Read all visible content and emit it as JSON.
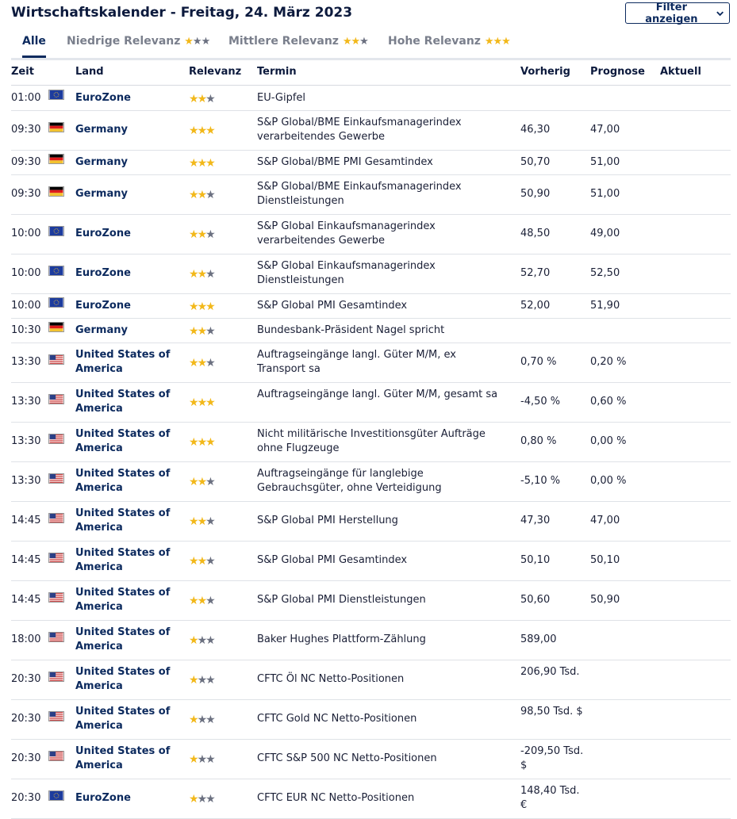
{
  "header": {
    "title": "Wirtschaftskalender - Freitag, 24. März 2023",
    "filter_label": "Filter anzeigen"
  },
  "tabs": [
    {
      "label": "Alle",
      "stars": 0,
      "active": true
    },
    {
      "label": "Niedrige Relevanz",
      "stars": 1,
      "active": false
    },
    {
      "label": "Mittlere Relevanz",
      "stars": 2,
      "active": false
    },
    {
      "label": "Hohe Relevanz",
      "stars": 3,
      "active": false
    }
  ],
  "columns": {
    "zeit": "Zeit",
    "land": "Land",
    "relevanz": "Relevanz",
    "termin": "Termin",
    "vorherig": "Vorherig",
    "prognose": "Prognose",
    "aktuell": "Aktuell"
  },
  "colors": {
    "brand": "#0c2a5e",
    "star_on": "#f2b81a",
    "star_off": "#6b7080"
  },
  "rows": [
    {
      "zeit": "01:00",
      "flag": "eu-flag-icon",
      "land": "EuroZone",
      "stars": 2,
      "termin": "EU-Gipfel",
      "vorherig": "",
      "prognose": "",
      "aktuell": ""
    },
    {
      "zeit": "09:30",
      "flag": "de-flag-icon",
      "land": "Germany",
      "stars": 3,
      "termin": "S&P Global/BME Einkaufsmanagerindex verarbeitendes Gewerbe",
      "vorherig": "46,30",
      "prognose": "47,00",
      "aktuell": ""
    },
    {
      "zeit": "09:30",
      "flag": "de-flag-icon",
      "land": "Germany",
      "stars": 3,
      "termin": "S&P Global/BME PMI Gesamtindex",
      "vorherig": "50,70",
      "prognose": "51,00",
      "aktuell": ""
    },
    {
      "zeit": "09:30",
      "flag": "de-flag-icon",
      "land": "Germany",
      "stars": 2,
      "termin": "S&P Global/BME Einkaufsmanagerindex Dienstleistungen",
      "vorherig": "50,90",
      "prognose": "51,00",
      "aktuell": ""
    },
    {
      "zeit": "10:00",
      "flag": "eu-flag-icon",
      "land": "EuroZone",
      "stars": 2,
      "termin": "S&P Global Einkaufsmanagerindex verarbeitendes Gewerbe",
      "vorherig": "48,50",
      "prognose": "49,00",
      "aktuell": ""
    },
    {
      "zeit": "10:00",
      "flag": "eu-flag-icon",
      "land": "EuroZone",
      "stars": 2,
      "termin": "S&P Global Einkaufsmanagerindex Dienstleistungen",
      "vorherig": "52,70",
      "prognose": "52,50",
      "aktuell": ""
    },
    {
      "zeit": "10:00",
      "flag": "eu-flag-icon",
      "land": "EuroZone",
      "stars": 3,
      "termin": "S&P Global PMI Gesamtindex",
      "vorherig": "52,00",
      "prognose": "51,90",
      "aktuell": ""
    },
    {
      "zeit": "10:30",
      "flag": "de-flag-icon",
      "land": "Germany",
      "stars": 2,
      "termin": "Bundesbank-Präsident Nagel spricht",
      "vorherig": "",
      "prognose": "",
      "aktuell": ""
    },
    {
      "zeit": "13:30",
      "flag": "us-flag-icon",
      "land": "United States of America",
      "stars": 2,
      "termin": "Auftragseingänge langl. Güter M/M, ex Transport sa",
      "vorherig": "0,70 %",
      "prognose": "0,20 %",
      "aktuell": ""
    },
    {
      "zeit": "13:30",
      "flag": "us-flag-icon",
      "land": "United States of America",
      "stars": 3,
      "termin": "Auftragseingänge langl. Güter M/M, gesamt sa",
      "vorherig": "-4,50 %",
      "prognose": "0,60 %",
      "aktuell": ""
    },
    {
      "zeit": "13:30",
      "flag": "us-flag-icon",
      "land": "United States of America",
      "stars": 3,
      "termin": "Nicht militärische Investitionsgüter Aufträge ohne Flugzeuge",
      "vorherig": "0,80 %",
      "prognose": "0,00 %",
      "aktuell": ""
    },
    {
      "zeit": "13:30",
      "flag": "us-flag-icon",
      "land": "United States of America",
      "stars": 2,
      "termin": "Auftragseingänge für langlebige Gebrauchsgüter, ohne Verteidigung",
      "vorherig": "-5,10 %",
      "prognose": "0,00 %",
      "aktuell": ""
    },
    {
      "zeit": "14:45",
      "flag": "us-flag-icon",
      "land": "United States of America",
      "stars": 2,
      "termin": "S&P Global PMI Herstellung",
      "vorherig": "47,30",
      "prognose": "47,00",
      "aktuell": ""
    },
    {
      "zeit": "14:45",
      "flag": "us-flag-icon",
      "land": "United States of America",
      "stars": 2,
      "termin": "S&P Global PMI Gesamtindex",
      "vorherig": "50,10",
      "prognose": "50,10",
      "aktuell": ""
    },
    {
      "zeit": "14:45",
      "flag": "us-flag-icon",
      "land": "United States of America",
      "stars": 2,
      "termin": "S&P Global PMI Dienstleistungen",
      "vorherig": "50,60",
      "prognose": "50,90",
      "aktuell": ""
    },
    {
      "zeit": "18:00",
      "flag": "us-flag-icon",
      "land": "United States of America",
      "stars": 1,
      "termin": "Baker Hughes Plattform-Zählung",
      "vorherig": "589,00",
      "prognose": "",
      "aktuell": ""
    },
    {
      "zeit": "20:30",
      "flag": "us-flag-icon",
      "land": "United States of America",
      "stars": 1,
      "termin": "CFTC Öl NC Netto-Positionen",
      "vorherig": "206,90 Tsd.",
      "prognose": "",
      "aktuell": ""
    },
    {
      "zeit": "20:30",
      "flag": "us-flag-icon",
      "land": "United States of America",
      "stars": 1,
      "termin": "CFTC Gold NC Netto-Positionen",
      "vorherig": "98,50 Tsd. $",
      "prognose": "",
      "aktuell": ""
    },
    {
      "zeit": "20:30",
      "flag": "us-flag-icon",
      "land": "United States of America",
      "stars": 1,
      "termin": "CFTC S&P 500 NC Netto-Positionen",
      "vorherig": "-209,50 Tsd. $",
      "prognose": "",
      "aktuell": ""
    },
    {
      "zeit": "20:30",
      "flag": "eu-flag-icon",
      "land": "EuroZone",
      "stars": 1,
      "termin": "CFTC EUR NC Netto-Positionen",
      "vorherig": "148,40 Tsd. €",
      "prognose": "",
      "aktuell": ""
    }
  ]
}
